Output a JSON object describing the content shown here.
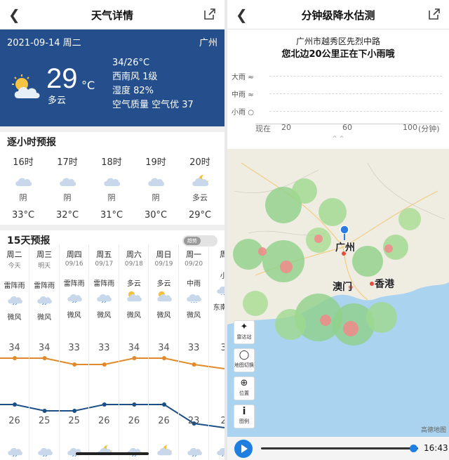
{
  "left": {
    "title": "天气详情",
    "hero": {
      "date": "2021-09-14 周二",
      "city": "广州",
      "temp": "29",
      "unit": "°C",
      "cond": "多云",
      "range": "34/26°C",
      "wind": "西南风 1级",
      "humidity": "湿度 82%",
      "air": "空气质量  空气优 37"
    },
    "hourly_title": "逐小时预报",
    "hourly": [
      {
        "time": "16时",
        "cond": "阴",
        "temp": "33°C",
        "icon": "cloud-icon"
      },
      {
        "time": "17时",
        "cond": "阴",
        "temp": "32°C",
        "icon": "cloud-icon"
      },
      {
        "time": "18时",
        "cond": "阴",
        "temp": "31°C",
        "icon": "cloud-icon"
      },
      {
        "time": "19时",
        "cond": "阴",
        "temp": "30°C",
        "icon": "cloud-icon"
      },
      {
        "time": "20时",
        "cond": "多云",
        "temp": "29°C",
        "icon": "moon-cloud-icon"
      }
    ],
    "daily_title": "15天预报",
    "toggle_label": "趋势",
    "daily": [
      {
        "day": "周二",
        "date": "今天",
        "cond": "雷阵雨",
        "wind": "微风",
        "hi": 34,
        "lo": 26
      },
      {
        "day": "周三",
        "date": "明天",
        "cond": "雷阵雨",
        "wind": "微风",
        "hi": 34,
        "lo": 25
      },
      {
        "day": "周四",
        "date": "09/16",
        "cond": "雷阵雨",
        "wind": "微风",
        "hi": 33,
        "lo": 25
      },
      {
        "day": "周五",
        "date": "09/17",
        "cond": "雷阵雨",
        "wind": "微风",
        "hi": 33,
        "lo": 26
      },
      {
        "day": "周六",
        "date": "09/18",
        "cond": "多云",
        "wind": "微风",
        "hi": 34,
        "lo": 26
      },
      {
        "day": "周日",
        "date": "09/19",
        "cond": "多云",
        "wind": "微风",
        "hi": 34,
        "lo": 26
      },
      {
        "day": "周一",
        "date": "09/20",
        "cond": "中雨",
        "wind": "微风",
        "hi": 33,
        "lo": 23
      },
      {
        "day": "周",
        "date": "",
        "cond": "小",
        "wind": "东南微",
        "hi": 3,
        "lo": 2
      }
    ],
    "colors": {
      "hero_bg": "#244f8c",
      "hi_line": "#e08a2b",
      "lo_line": "#1d4f87"
    }
  },
  "right": {
    "title": "分钟级降水估测",
    "location": "广州市越秀区先烈中路",
    "forecast": "您北边20公里正在下小雨哦",
    "levels": [
      "大雨",
      "中雨",
      "小雨"
    ],
    "xticks": [
      "现在",
      "20",
      "60",
      "100",
      "(分钟)"
    ],
    "tools": [
      {
        "label": "雷达站",
        "icon": "radar-icon"
      },
      {
        "label": "地图切换",
        "icon": "layers-icon"
      },
      {
        "label": "位置",
        "icon": "locate-icon"
      },
      {
        "label": "图例",
        "icon": "info-icon"
      }
    ],
    "cities": [
      "广州",
      "澳门",
      "香港"
    ],
    "map_credit": "高德地图",
    "time": "16:43",
    "progress": 0.97
  }
}
